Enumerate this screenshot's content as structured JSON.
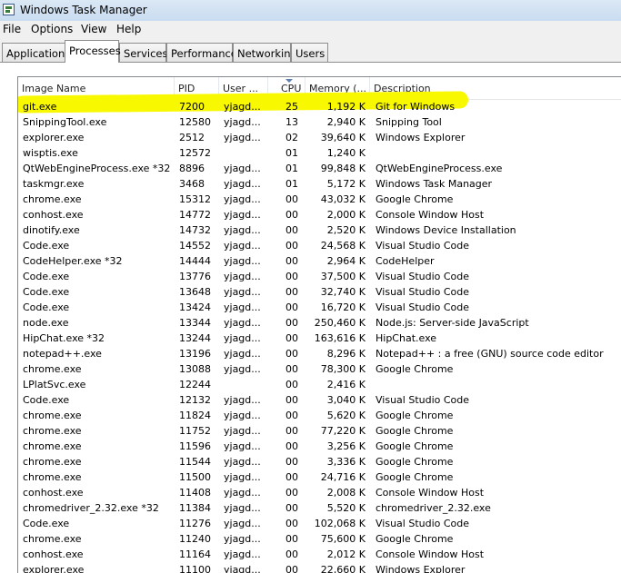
{
  "window": {
    "title": "Windows Task Manager"
  },
  "menu": [
    {
      "label": "File"
    },
    {
      "label": "Options"
    },
    {
      "label": "View"
    },
    {
      "label": "Help"
    }
  ],
  "tabs": [
    {
      "label": "Applications"
    },
    {
      "label": "Processes",
      "active": true
    },
    {
      "label": "Services"
    },
    {
      "label": "Performance"
    },
    {
      "label": "Networking"
    },
    {
      "label": "Users"
    }
  ],
  "columns": [
    {
      "label": "Image Name"
    },
    {
      "label": "PID"
    },
    {
      "label": "User ..."
    },
    {
      "label": "CPU",
      "sorted": "descending"
    },
    {
      "label": "Memory (..."
    },
    {
      "label": "Description"
    }
  ],
  "colors": {
    "highlight": "#f8f800"
  },
  "processes": [
    [
      "git.exe",
      "7200",
      "yjagd...",
      "25",
      "1,192 K",
      "Git for Windows"
    ],
    [
      "SnippingTool.exe",
      "12580",
      "yjagd...",
      "13",
      "2,940 K",
      "Snipping Tool"
    ],
    [
      "explorer.exe",
      "2512",
      "yjagd...",
      "02",
      "39,640 K",
      "Windows Explorer"
    ],
    [
      "wisptis.exe",
      "12572",
      "",
      "01",
      "1,240 K",
      ""
    ],
    [
      "QtWebEngineProcess.exe *32",
      "8896",
      "yjagd...",
      "01",
      "99,848 K",
      "QtWebEngineProcess.exe"
    ],
    [
      "taskmgr.exe",
      "3468",
      "yjagd...",
      "01",
      "5,172 K",
      "Windows Task Manager"
    ],
    [
      "chrome.exe",
      "15312",
      "yjagd...",
      "00",
      "43,032 K",
      "Google Chrome"
    ],
    [
      "conhost.exe",
      "14772",
      "yjagd...",
      "00",
      "2,000 K",
      "Console Window Host"
    ],
    [
      "dinotify.exe",
      "14732",
      "yjagd...",
      "00",
      "2,520 K",
      "Windows Device Installation"
    ],
    [
      "Code.exe",
      "14552",
      "yjagd...",
      "00",
      "24,568 K",
      "Visual Studio Code"
    ],
    [
      "CodeHelper.exe *32",
      "14444",
      "yjagd...",
      "00",
      "2,964 K",
      "CodeHelper"
    ],
    [
      "Code.exe",
      "13776",
      "yjagd...",
      "00",
      "37,500 K",
      "Visual Studio Code"
    ],
    [
      "Code.exe",
      "13648",
      "yjagd...",
      "00",
      "32,740 K",
      "Visual Studio Code"
    ],
    [
      "Code.exe",
      "13424",
      "yjagd...",
      "00",
      "16,720 K",
      "Visual Studio Code"
    ],
    [
      "node.exe",
      "13344",
      "yjagd...",
      "00",
      "250,460 K",
      "Node.js: Server-side JavaScript"
    ],
    [
      "HipChat.exe *32",
      "13244",
      "yjagd...",
      "00",
      "163,616 K",
      "HipChat.exe"
    ],
    [
      "notepad++.exe",
      "13196",
      "yjagd...",
      "00",
      "8,296 K",
      "Notepad++ : a free (GNU) source code editor"
    ],
    [
      "chrome.exe",
      "13088",
      "yjagd...",
      "00",
      "78,300 K",
      "Google Chrome"
    ],
    [
      "LPlatSvc.exe",
      "12244",
      "",
      "00",
      "2,416 K",
      ""
    ],
    [
      "Code.exe",
      "12132",
      "yjagd...",
      "00",
      "3,040 K",
      "Visual Studio Code"
    ],
    [
      "chrome.exe",
      "11824",
      "yjagd...",
      "00",
      "5,620 K",
      "Google Chrome"
    ],
    [
      "chrome.exe",
      "11752",
      "yjagd...",
      "00",
      "77,220 K",
      "Google Chrome"
    ],
    [
      "chrome.exe",
      "11596",
      "yjagd...",
      "00",
      "3,256 K",
      "Google Chrome"
    ],
    [
      "chrome.exe",
      "11544",
      "yjagd...",
      "00",
      "3,336 K",
      "Google Chrome"
    ],
    [
      "chrome.exe",
      "11500",
      "yjagd...",
      "00",
      "24,716 K",
      "Google Chrome"
    ],
    [
      "conhost.exe",
      "11408",
      "yjagd...",
      "00",
      "2,008 K",
      "Console Window Host"
    ],
    [
      "chromedriver_2.32.exe *32",
      "11384",
      "yjagd...",
      "00",
      "5,520 K",
      "chromedriver_2.32.exe"
    ],
    [
      "Code.exe",
      "11276",
      "yjagd...",
      "00",
      "102,068 K",
      "Visual Studio Code"
    ],
    [
      "chrome.exe",
      "11240",
      "yjagd...",
      "00",
      "75,600 K",
      "Google Chrome"
    ],
    [
      "conhost.exe",
      "11164",
      "yjagd...",
      "00",
      "2,012 K",
      "Console Window Host"
    ],
    [
      "explorer.exe",
      "11100",
      "yjagd...",
      "00",
      "22,660 K",
      "Windows Explorer"
    ]
  ]
}
